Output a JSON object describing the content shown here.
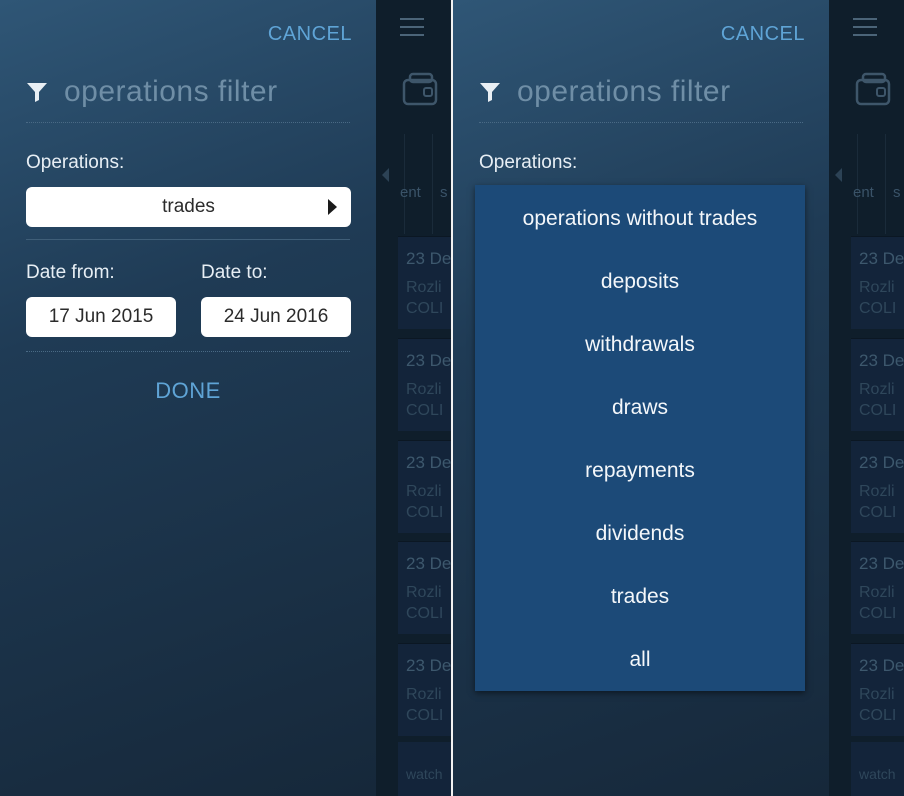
{
  "filter": {
    "cancel_label": "CANCEL",
    "title": "operations filter",
    "operations_label": "Operations:",
    "operations_selected": "trades",
    "date_from_label": "Date from:",
    "date_to_label": "Date to:",
    "date_from_value": "17 Jun 2015",
    "date_to_value": "24 Jun 2016",
    "done_label": "DONE"
  },
  "dropdown": {
    "options": [
      "operations without trades",
      "deposits",
      "withdrawals",
      "draws",
      "repayments",
      "dividends",
      "trades",
      "all"
    ]
  },
  "background_app": {
    "tab_texts": [
      "ent",
      "s"
    ],
    "rows": [
      {
        "date": "23 De",
        "line1": "Rozli",
        "line2": "COLI"
      },
      {
        "date": "23 De",
        "line1": "Rozli",
        "line2": "COLI"
      },
      {
        "date": "23 De",
        "line1": "Rozli",
        "line2": "COLI"
      },
      {
        "date": "23 De",
        "line1": "Rozli",
        "line2": "COLI"
      },
      {
        "date": "23 De",
        "line1": "Rozli",
        "line2": "COLI"
      }
    ],
    "watch_label": "watch"
  },
  "colors": {
    "accent": "#5fa4d6",
    "panel_top": "#2f5676",
    "panel_bottom": "#16283a",
    "dropdown_bg": "#1c4a78"
  },
  "icons": [
    "funnel-icon",
    "hamburger-icon",
    "wallet-icon",
    "triangle-right-icon",
    "chevron-left-icon"
  ]
}
